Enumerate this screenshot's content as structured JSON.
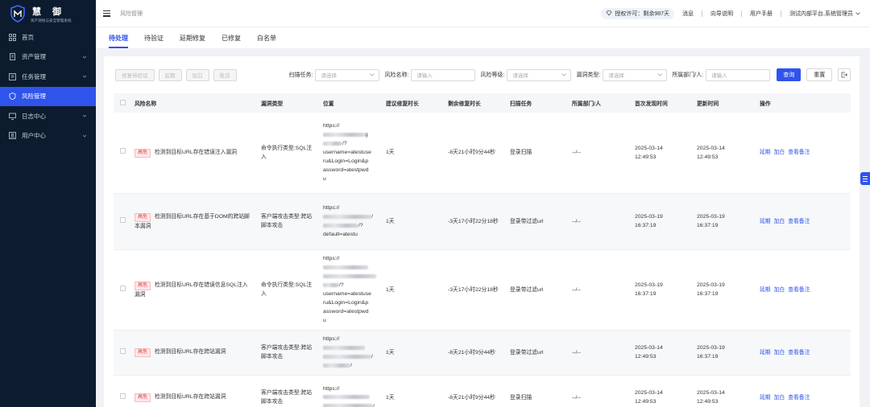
{
  "brand": {
    "title": "慧御",
    "subtitle": "资产测绘与安全管理系统"
  },
  "sidebar": {
    "items": [
      {
        "label": "首页",
        "icon": "grid-icon",
        "active": false,
        "expandable": false
      },
      {
        "label": "资产管理",
        "icon": "file-icon",
        "active": false,
        "expandable": true
      },
      {
        "label": "任务管理",
        "icon": "list-icon",
        "active": false,
        "expandable": true
      },
      {
        "label": "风险管理",
        "icon": "shield-icon",
        "active": true,
        "expandable": false
      },
      {
        "label": "日志中心",
        "icon": "monitor-icon",
        "active": false,
        "expandable": true
      },
      {
        "label": "用户中心",
        "icon": "user-icon",
        "active": false,
        "expandable": true
      }
    ]
  },
  "header": {
    "breadcrumb": "风险管理",
    "license": "授权许可：剩余987天",
    "links": [
      "消息",
      "向导说明",
      "用户手册"
    ],
    "user": "测试内部平台,系统管理员"
  },
  "tabs": [
    "待处理",
    "待验证",
    "延期修复",
    "已修复",
    "白名单"
  ],
  "toolbar": {
    "buttons": [
      "修复待验证",
      "延期",
      "加白",
      "批话"
    ]
  },
  "filters": {
    "scan_task": {
      "label": "扫描任务:",
      "placeholder": "请选择"
    },
    "risk_name": {
      "label": "风险名称:",
      "placeholder": "请输入"
    },
    "risk_level": {
      "label": "风险等级:",
      "placeholder": "请选择"
    },
    "vuln_type": {
      "label": "漏洞类型:",
      "placeholder": "请选择"
    },
    "department": {
      "label": "所属部门/人:",
      "placeholder": "请输入"
    },
    "query": "查询",
    "reset": "重置"
  },
  "table": {
    "columns": [
      "风险名称",
      "漏洞类型",
      "位置",
      "建议修复时长",
      "剩余修复时长",
      "扫描任务",
      "所属部门/人",
      "首次发现时间",
      "更新时间",
      "操作"
    ],
    "rows": [
      {
        "level": "高危",
        "name": "检测到目标URL存在错误注入漏洞",
        "type": "命令执行类型:SQL注入",
        "loc": [
          "https://",
          "g",
          "/?",
          "username=atestuse",
          "ru&Login=Login&p",
          "assword=atestpwd",
          "u"
        ],
        "suggest": "1天",
        "remain": "-8天21小时9分44秒",
        "task": "登录扫描",
        "dept": "--/--",
        "first": [
          "2025-03-14",
          "12:49:53"
        ],
        "update": [
          "2025-03-14",
          "12:49:53"
        ],
        "ops": [
          "延期",
          "加白",
          "查看备注"
        ]
      },
      {
        "level": "高危",
        "name": "检测到目标URL存在基于DOM的跨站脚本漏洞",
        "type": "客户端攻击类型:跨站脚本攻击",
        "loc": [
          "https://",
          "/",
          "/?",
          "default=atestu"
        ],
        "suggest": "1天",
        "remain": "-3天17小时22分18秒",
        "task": "登录带过滤url",
        "dept": "--/--",
        "first": [
          "2025-03-19",
          "16:37:19"
        ],
        "update": [
          "2025-03-19",
          "16:37:19"
        ],
        "ops": [
          "延期",
          "加白",
          "查看备注"
        ]
      },
      {
        "level": "高危",
        "name": "检测到目标URL存在错误信息SQL注入漏洞",
        "type": "命令执行类型:SQL注入",
        "loc": [
          "https://",
          "",
          "",
          "/?",
          "username=atestuse",
          "ru&Login=Login&p",
          "assword=atestpwd",
          "u"
        ],
        "suggest": "1天",
        "remain": "-3天17小时22分18秒",
        "task": "登录带过滤url",
        "dept": "--/--",
        "first": [
          "2025-03-19",
          "16:37:19"
        ],
        "update": [
          "2025-03-19",
          "16:37:19"
        ],
        "ops": [
          "延期",
          "加白",
          "查看备注"
        ]
      },
      {
        "level": "高危",
        "name": "检测到目标URL存在跨站漏洞",
        "type": "客户端攻击类型:跨站脚本攻击",
        "loc": [
          "https://",
          "",
          "/",
          "/"
        ],
        "suggest": "1天",
        "remain": "-8天21小时9分44秒",
        "task": "登录带过滤url",
        "dept": "--/--",
        "first": [
          "2025-03-14",
          "12:49:53"
        ],
        "update": [
          "2025-03-19",
          "16:37:19"
        ],
        "ops": [
          "延期",
          "加白",
          "查看备注"
        ]
      },
      {
        "level": "高危",
        "name": "检测到目标URL存在跨站漏洞",
        "type": "客户端攻击类型:跨站脚本攻击",
        "loc": [
          "https://",
          "",
          "/"
        ],
        "suggest": "1天",
        "remain": "-8天21小时9分44秒",
        "task": "登录扫描",
        "dept": "--/--",
        "first": [
          "2025-03-14",
          "12:49:53"
        ],
        "update": [
          "2025-03-14",
          "12:49:53"
        ],
        "ops": [
          "延期",
          "加白",
          "查看备注"
        ]
      }
    ]
  }
}
